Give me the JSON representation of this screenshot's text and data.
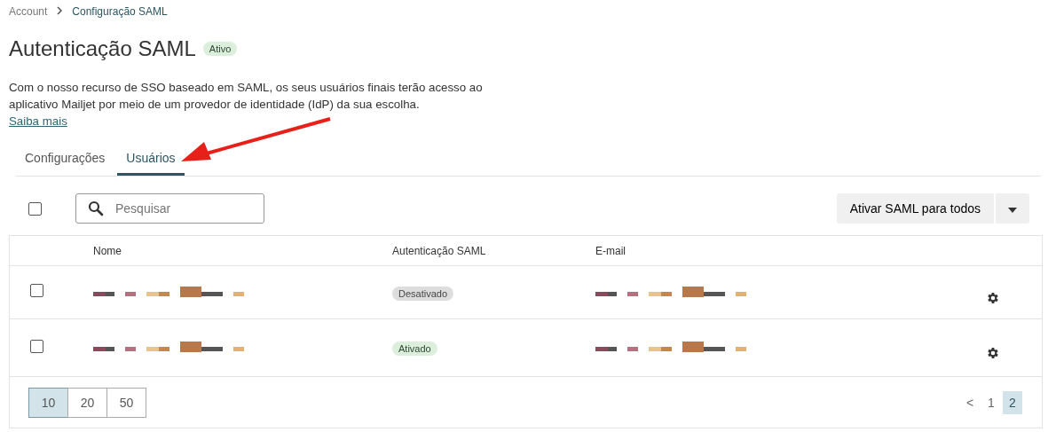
{
  "breadcrumb": [
    {
      "label": "Account",
      "current": false
    },
    {
      "label": "Configuração SAML",
      "current": true
    }
  ],
  "title": "Autenticação SAML",
  "status_badge": "Ativo",
  "description": {
    "text": "Com o nosso recurso de SSO baseado em SAML, os seus usuários finais terão acesso ao aplicativo Mailjet por meio de um provedor de identidade (IdP) da sua escolha.",
    "link": "Saiba mais"
  },
  "tabs": [
    {
      "label": "Configurações",
      "selected": false
    },
    {
      "label": "Usuários",
      "selected": true
    }
  ],
  "toolbar": {
    "select_all_checked": false,
    "search": {
      "placeholder": "Pesquisar"
    },
    "action_button": "Ativar SAML para todos"
  },
  "table": {
    "columns": [
      "Nome",
      "Autenticação SAML",
      "E-mail"
    ],
    "rows": [
      {
        "checked": false,
        "saml": {
          "label": "Desativado",
          "active": false
        }
      },
      {
        "checked": false,
        "saml": {
          "label": "Ativado",
          "active": true
        }
      }
    ]
  },
  "pagination": {
    "page_sizes": [
      {
        "label": "10",
        "selected": true
      },
      {
        "label": "20",
        "selected": false
      },
      {
        "label": "50",
        "selected": false
      }
    ],
    "prev": "<",
    "pages": [
      {
        "label": "1",
        "selected": false
      },
      {
        "label": "2",
        "selected": true
      }
    ]
  }
}
